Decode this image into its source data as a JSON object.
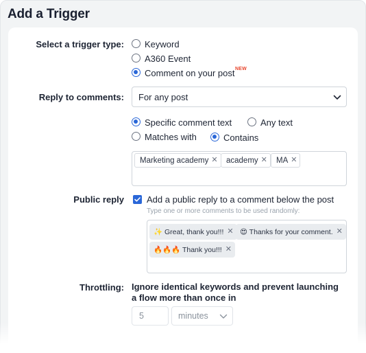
{
  "title": "Add a Trigger",
  "trigger_type": {
    "label": "Select a trigger type:",
    "options": [
      "Keyword",
      "A360 Event",
      "Comment on your post"
    ],
    "selected": "Comment on your post",
    "new_badge": "NEW"
  },
  "reply_to_comments": {
    "label": "Reply to comments:",
    "selected": "For any post"
  },
  "text_mode": {
    "options": [
      "Specific comment text",
      "Any text"
    ],
    "selected": "Specific comment text"
  },
  "match_mode": {
    "options": [
      "Matches with",
      "Contains"
    ],
    "selected": "Contains"
  },
  "keywords": [
    "Marketing academy",
    "academy",
    "MA"
  ],
  "public_reply": {
    "label": "Public reply",
    "checkbox_label": "Add a public reply to a comment below the post",
    "checked": true,
    "hint": "Type one or more comments to be used randomly:",
    "comments": [
      "✨ Great, thank you!!!",
      "😍 Thanks for your comment.",
      "🔥🔥🔥 Thank you!!!"
    ]
  },
  "throttling": {
    "label": "Throttling:",
    "line1": "Ignore identical keywords and prevent launching",
    "line2": "a flow more than once in",
    "value": "5",
    "unit": "minutes"
  },
  "colors": {
    "accent": "#2a67d8",
    "new_badge": "#e8452c"
  }
}
